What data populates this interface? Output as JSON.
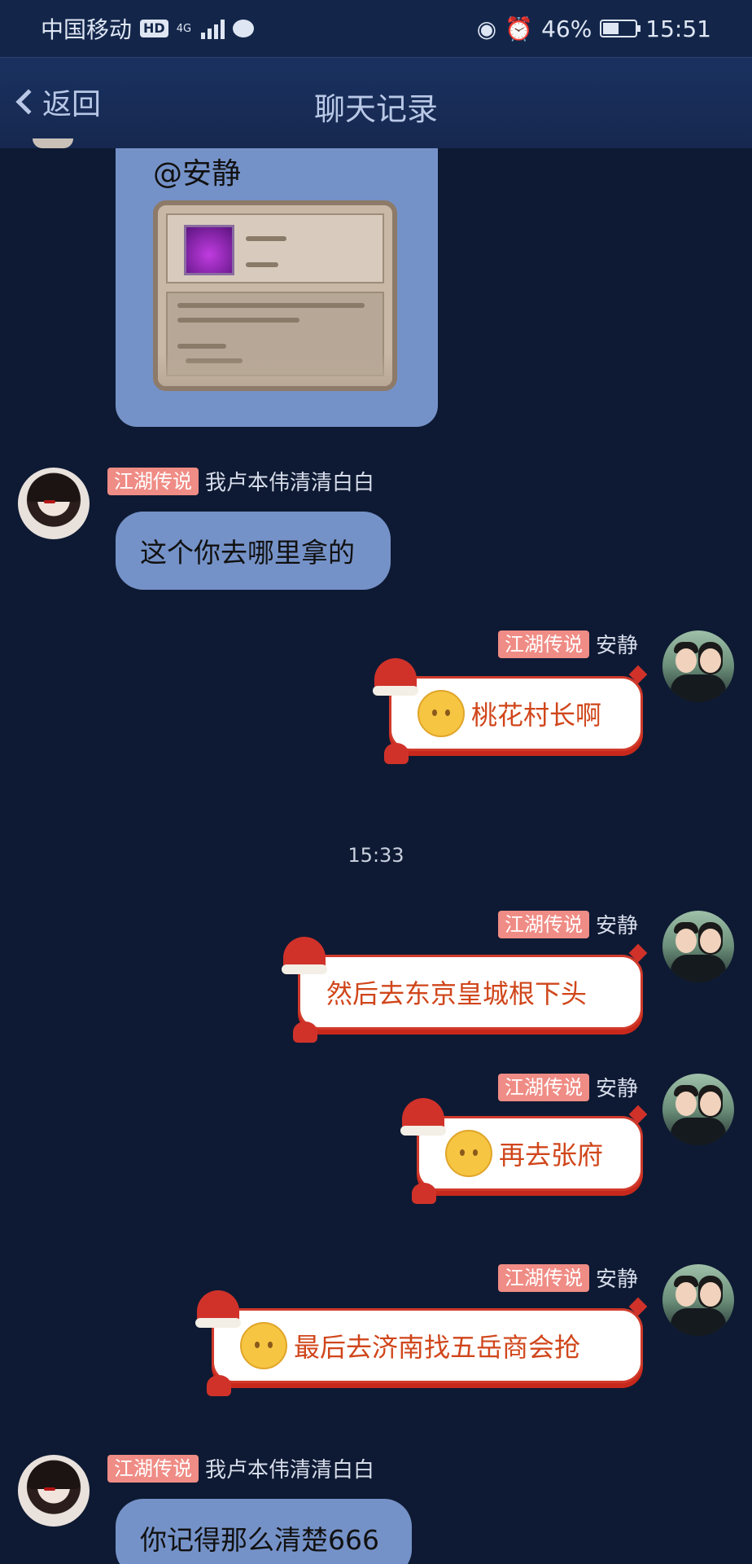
{
  "status_bar": {
    "carrier": "中国移动",
    "hd": "HD",
    "network": "4G",
    "battery": "46%",
    "time": "15:51",
    "icons": [
      "hd-badge",
      "signal-icon",
      "message-icon",
      "eye-icon",
      "alarm-icon",
      "battery-icon"
    ]
  },
  "header": {
    "back_label": "返回",
    "title": "聊天记录"
  },
  "messages": [
    {
      "type": "image",
      "mention": "@安静"
    },
    {
      "tag": "江湖传说",
      "name": "我卢本伟清清白白",
      "text": "这个你去哪里拿的",
      "side": "left"
    },
    {
      "tag": "江湖传说",
      "name": "安静",
      "text": "桃花村长啊",
      "side": "right",
      "emoji": true
    },
    {
      "timestamp": "15:33"
    },
    {
      "tag": "江湖传说",
      "name": "安静",
      "text": "然后去东京皇城根下头",
      "side": "right",
      "emoji": false
    },
    {
      "tag": "江湖传说",
      "name": "安静",
      "text": "再去张府",
      "side": "right",
      "emoji": true
    },
    {
      "tag": "江湖传说",
      "name": "安静",
      "text": "最后去济南找五岳商会抢",
      "side": "right",
      "emoji": true
    },
    {
      "tag": "江湖传说",
      "name": "我卢本伟清清白白",
      "text": "你记得那么清楚666",
      "side": "left"
    }
  ],
  "colors": {
    "background": "#0e1a33",
    "bubble": "#7592c8",
    "tag": "#ef8c85",
    "xmas_text": "#d0461b"
  }
}
